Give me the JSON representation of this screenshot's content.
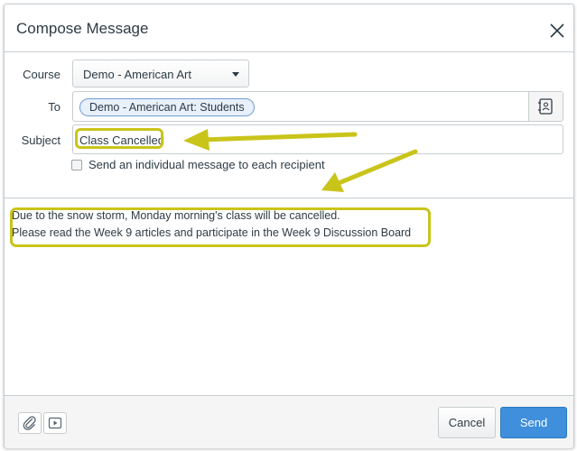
{
  "dialog": {
    "title": "Compose Message"
  },
  "form": {
    "course_label": "Course",
    "course_value": "Demo - American Art",
    "to_label": "To",
    "to_token": "Demo - American Art: Students",
    "subject_label": "Subject",
    "subject_value": "Class Cancelled",
    "individual_label": "Send an individual message to each recipient"
  },
  "message": {
    "line1": "Due to the snow storm, Monday morning's class will be cancelled.",
    "line2": "Please read the Week 9 articles and participate in the Week 9 Discussion Board"
  },
  "footer": {
    "cancel_label": "Cancel",
    "send_label": "Send"
  },
  "colors": {
    "highlight": "#c9c41a",
    "primary": "#3f8fdc"
  },
  "icons": [
    "close-icon",
    "address-book-icon",
    "attachment-icon",
    "media-icon",
    "chevron-down-icon"
  ]
}
